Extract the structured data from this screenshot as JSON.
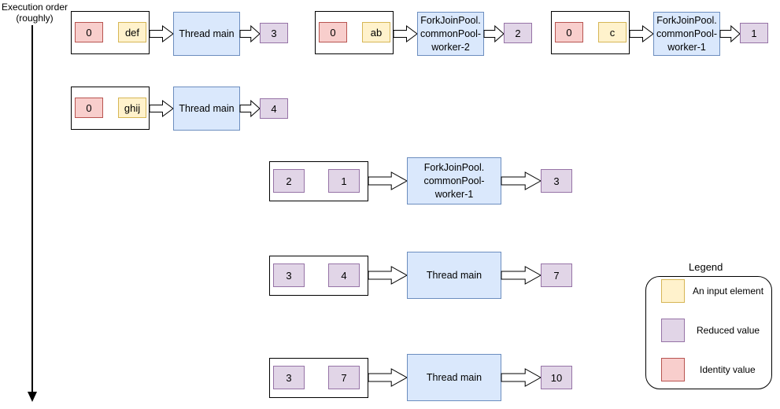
{
  "axis": {
    "label_line1": "Execution order",
    "label_line2": "(roughly)"
  },
  "colors": {
    "identity_fill": "#f8cecc",
    "identity_stroke": "#b85450",
    "input_fill": "#fff2cc",
    "input_stroke": "#d6b656",
    "reduced_fill": "#e1d5e7",
    "reduced_stroke": "#9673a6",
    "thread_fill": "#dae8fc",
    "thread_stroke": "#6c8ebf"
  },
  "steps": [
    {
      "left": "0",
      "left_kind": "identity",
      "right": "def",
      "right_kind": "input",
      "thread": "Thread main",
      "result": "3"
    },
    {
      "left": "0",
      "left_kind": "identity",
      "right": "ab",
      "right_kind": "input",
      "thread": "ForkJoinPool.\ncommonPool-\nworker-2",
      "result": "2"
    },
    {
      "left": "0",
      "left_kind": "identity",
      "right": "c",
      "right_kind": "input",
      "thread": "ForkJoinPool.\ncommonPool-\nworker-1",
      "result": "1"
    },
    {
      "left": "0",
      "left_kind": "identity",
      "right": "ghij",
      "right_kind": "input",
      "thread": "Thread main",
      "result": "4"
    },
    {
      "left": "2",
      "left_kind": "reduced",
      "right": "1",
      "right_kind": "reduced",
      "thread": "ForkJoinPool.\ncommonPool-\nworker-1",
      "result": "3"
    },
    {
      "left": "3",
      "left_kind": "reduced",
      "right": "4",
      "right_kind": "reduced",
      "thread": "Thread main",
      "result": "7"
    },
    {
      "left": "3",
      "left_kind": "reduced",
      "right": "7",
      "right_kind": "reduced",
      "thread": "Thread main",
      "result": "10"
    }
  ],
  "legend": {
    "title": "Legend",
    "items": [
      {
        "kind": "input",
        "label": "An input element"
      },
      {
        "kind": "reduced",
        "label": "Reduced value"
      },
      {
        "kind": "identity",
        "label": "Identity value"
      }
    ]
  }
}
